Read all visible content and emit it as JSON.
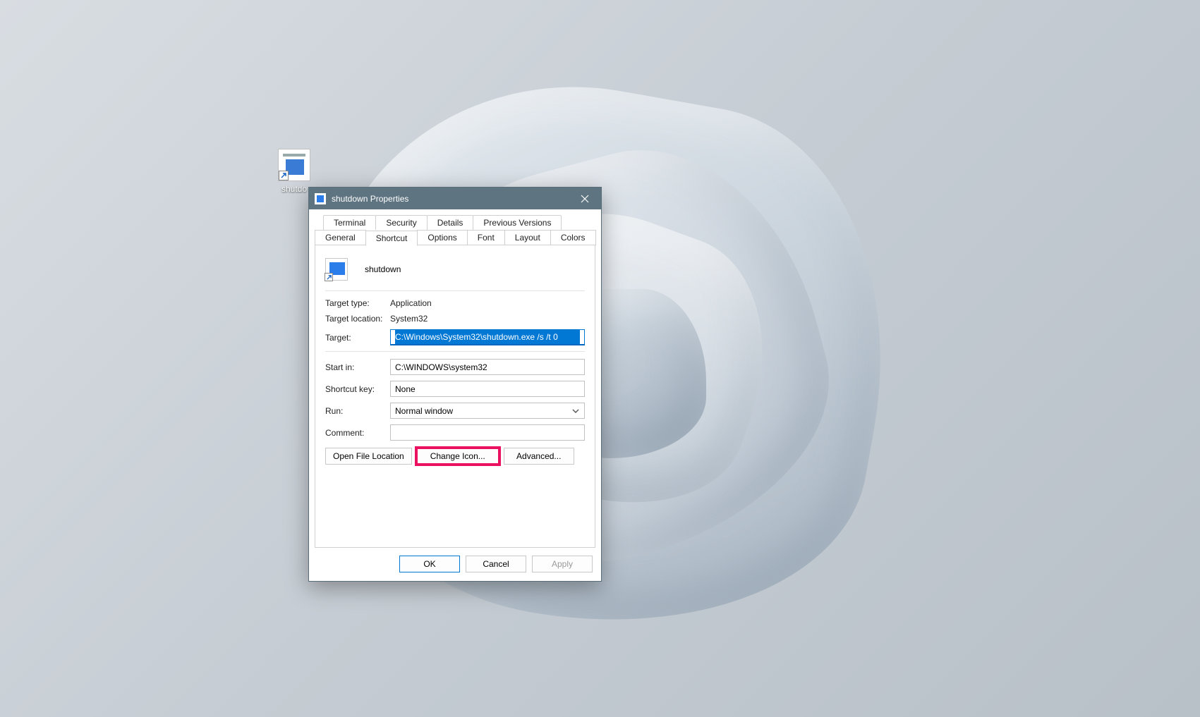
{
  "desktop": {
    "shortcut_label": "shutdo"
  },
  "dialog": {
    "title": "shutdown Properties",
    "tabs_back": [
      "Terminal",
      "Security",
      "Details",
      "Previous Versions"
    ],
    "tabs_front": [
      "General",
      "Shortcut",
      "Options",
      "Font",
      "Layout",
      "Colors"
    ],
    "active_tab": "Shortcut",
    "header_name": "shutdown",
    "fields": {
      "target_type_label": "Target type:",
      "target_type_value": "Application",
      "target_location_label": "Target location:",
      "target_location_value": "System32",
      "target_label": "Target:",
      "target_value": "C:\\Windows\\System32\\shutdown.exe /s /t 0",
      "start_in_label": "Start in:",
      "start_in_value": "C:\\WINDOWS\\system32",
      "shortcut_key_label": "Shortcut key:",
      "shortcut_key_value": "None",
      "run_label": "Run:",
      "run_value": "Normal window",
      "comment_label": "Comment:",
      "comment_value": ""
    },
    "buttons": {
      "open_file_location": "Open File Location",
      "change_icon": "Change Icon...",
      "advanced": "Advanced..."
    },
    "footer": {
      "ok": "OK",
      "cancel": "Cancel",
      "apply": "Apply"
    }
  }
}
